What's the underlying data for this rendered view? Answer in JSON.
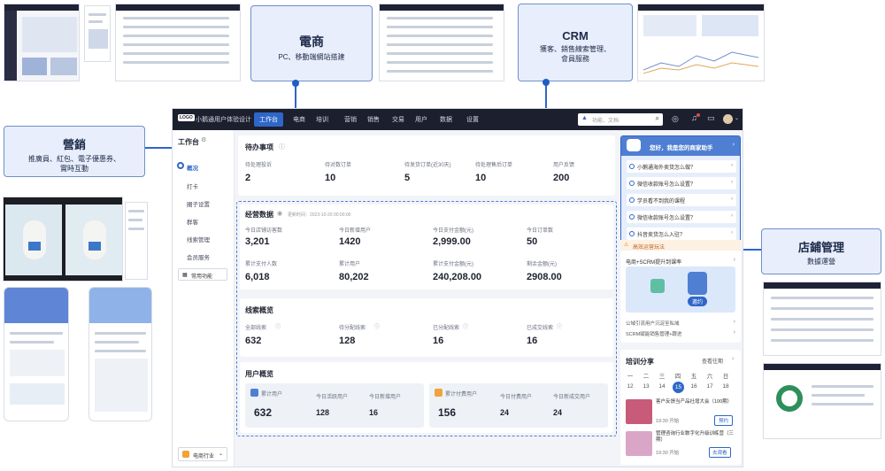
{
  "callouts": {
    "ecommerce": {
      "title": "電商",
      "sub": "PC、移動端網站搭建"
    },
    "crm": {
      "title": "CRM",
      "sub1": "獲客、銷售線索管理、",
      "sub2": "會員服務"
    },
    "marketing": {
      "title": "營銷",
      "sub1": "推廣員、紅包、電子優惠券、",
      "sub2": "實時互動"
    },
    "store": {
      "title": "店鋪管理",
      "sub": "數據運營"
    }
  },
  "topbar": {
    "logo": "LOGO",
    "title": "小鹅通用户体验设计",
    "nav": [
      "工作台",
      "电商",
      "培训",
      "营销",
      "销售",
      "交易",
      "用户",
      "数据",
      "设置"
    ],
    "search_placeholder": "功能、文档"
  },
  "sidebar": {
    "title": "工作台",
    "items": [
      "概况",
      "打卡",
      "圈子设置",
      "群客",
      "线索管理",
      "会员服务"
    ],
    "common_button": "常用功能",
    "industry_button": "电商行业"
  },
  "todo": {
    "title": "待办事项",
    "items": [
      {
        "label": "待处理投诉",
        "value": "2"
      },
      {
        "label": "待对数订单",
        "value": "10"
      },
      {
        "label": "待发货订单(近30天)",
        "value": "5"
      },
      {
        "label": "待处理售后订单",
        "value": "10"
      },
      {
        "label": "用户反馈",
        "value": "200"
      }
    ]
  },
  "business": {
    "title": "经营数据",
    "updated": "更新时间：2023-10-20 00:00:00",
    "row1": [
      {
        "label": "今日店铺访客数",
        "value": "3,201"
      },
      {
        "label": "今日新增用户",
        "value": "1420"
      },
      {
        "label": "今日支付金额(元)",
        "value": "2,999.00"
      },
      {
        "label": "今日订单数",
        "value": "50"
      }
    ],
    "row2": [
      {
        "label": "累计支付人数",
        "value": "6,018"
      },
      {
        "label": "累计用户",
        "value": "80,202"
      },
      {
        "label": "累计支付金额(元)",
        "value": "240,208.00"
      },
      {
        "label": "剩余金额(元)",
        "value": "2908.00"
      }
    ]
  },
  "leads": {
    "title": "线索概览",
    "items": [
      {
        "label": "全部线索",
        "value": "632"
      },
      {
        "label": "待分配线索",
        "value": "128"
      },
      {
        "label": "已分配线索",
        "value": "16"
      },
      {
        "label": "已成交线索",
        "value": "16"
      }
    ]
  },
  "users": {
    "title": "用户概览",
    "left": {
      "head_label": "累计用户",
      "head_value": "632",
      "a_label": "今日活跃用户",
      "a_value": "128",
      "b_label": "今日新增用户",
      "b_value": "16"
    },
    "right": {
      "head_label": "累计付费用户",
      "head_value": "156",
      "a_label": "今日付费用户",
      "a_value": "24",
      "b_label": "今日新成交用户",
      "b_value": "24"
    }
  },
  "assistant": {
    "greeting": "您好，我是您的商家助手",
    "questions": [
      "小鹅通海外卖货怎么做？",
      "微信收款账号怎么设置？",
      "学员看不到我的课程",
      "微信收款账号怎么设置？",
      "抖音卖货怎么入驻？"
    ]
  },
  "promo": {
    "header": "高效运营玩法",
    "banner_title": "电商+SCRM提升到课率",
    "banner_button": "邀约",
    "links": [
      "公域引流用户沉淀至私域",
      "SCRM赋能销售管理+跟进"
    ]
  },
  "training": {
    "title": "培训分享",
    "more": "查看往期",
    "weekdays": [
      "一",
      "二",
      "三",
      "四",
      "五",
      "六",
      "日"
    ],
    "dates": [
      "12",
      "13",
      "14",
      "15",
      "16",
      "17",
      "18"
    ],
    "selected_date": "15",
    "sessions": [
      {
        "title": "客户反馈当产品社增大会（100期）",
        "time": "19:30 开始",
        "action": "预约"
      },
      {
        "title": "管理咨询行业数字化升级训练营（三期）",
        "time": "19:30 开始",
        "action": "去观看"
      }
    ]
  }
}
